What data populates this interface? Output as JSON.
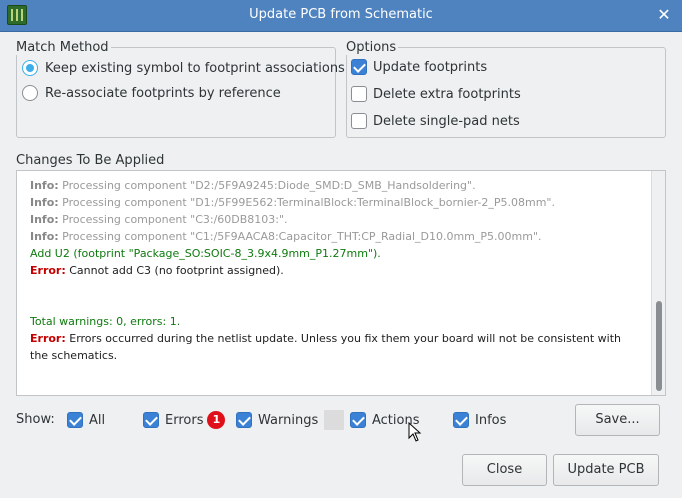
{
  "window": {
    "title": "Update PCB from Schematic"
  },
  "match_method": {
    "title": "Match Method",
    "options": [
      {
        "label": "Keep existing symbol to footprint associations",
        "selected": true
      },
      {
        "label": "Re-associate footprints by reference",
        "selected": false
      }
    ]
  },
  "options": {
    "title": "Options",
    "items": [
      {
        "label": "Update footprints",
        "checked": true
      },
      {
        "label": "Delete extra footprints",
        "checked": false
      },
      {
        "label": "Delete single-pad nets",
        "checked": false
      }
    ]
  },
  "changes": {
    "title": "Changes To Be Applied",
    "lines": [
      {
        "kind": "info",
        "prefix": "Info:",
        "text": "Processing component \"D2:/5F9A9245:Diode_SMD:D_SMB_Handsoldering\"."
      },
      {
        "kind": "info",
        "prefix": "Info:",
        "text": "Processing component \"D1:/5F99E562:TerminalBlock:TerminalBlock_bornier-2_P5.08mm\"."
      },
      {
        "kind": "info",
        "prefix": "Info:",
        "text": "Processing component \"C3:/60DB8103:\"."
      },
      {
        "kind": "info",
        "prefix": "Info:",
        "text": "Processing component \"C1:/5F9AACA8:Capacitor_THT:CP_Radial_D10.0mm_P5.00mm\"."
      },
      {
        "kind": "action",
        "prefix": "",
        "text": "Add U2 (footprint \"Package_SO:SOIC-8_3.9x4.9mm_P1.27mm\")."
      },
      {
        "kind": "error",
        "prefix": "Error:",
        "text": "Cannot add C3 (no footprint assigned)."
      },
      {
        "kind": "blank",
        "prefix": "",
        "text": ""
      },
      {
        "kind": "blank",
        "prefix": "",
        "text": ""
      },
      {
        "kind": "action",
        "prefix": "",
        "text": "Total warnings: 0, errors: 1."
      },
      {
        "kind": "error",
        "prefix": "Error:",
        "text": "Errors occurred during the netlist update. Unless you fix them your board will not be consistent with the schematics."
      }
    ]
  },
  "filters": {
    "show_label": "Show:",
    "all": "All",
    "errors": "Errors",
    "error_count": "1",
    "warnings": "Warnings",
    "actions": "Actions",
    "infos": "Infos"
  },
  "buttons": {
    "save": "Save...",
    "close": "Close",
    "update": "Update PCB"
  },
  "colors": {
    "titlebar": "#4e83c0",
    "accent": "#3daee9",
    "error": "#c40000",
    "action": "#0e7a0e",
    "badge": "#e0101b"
  }
}
